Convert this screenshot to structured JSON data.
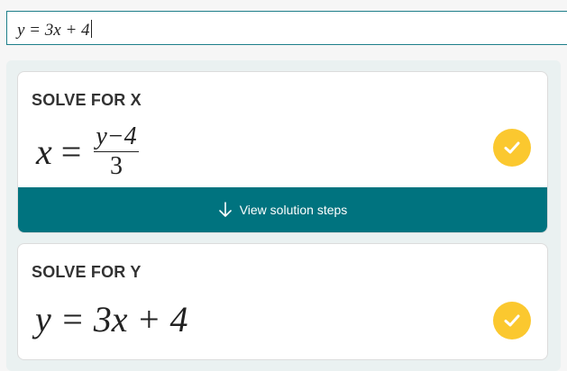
{
  "input": {
    "value": "y = 3x + 4"
  },
  "results": [
    {
      "title": "SOLVE FOR X",
      "lhs": "x",
      "eq": "=",
      "numerator": "y−4",
      "denominator": "3",
      "action_label": "View solution steps"
    },
    {
      "title": "SOLVE FOR Y",
      "expression": "y = 3x + 4"
    }
  ],
  "colors": {
    "accent": "#00737f",
    "check": "#fbc82f",
    "input_border": "#1e7f8a"
  },
  "icons": {
    "check": "checkmark-icon",
    "arrow": "arrow-down-icon"
  }
}
